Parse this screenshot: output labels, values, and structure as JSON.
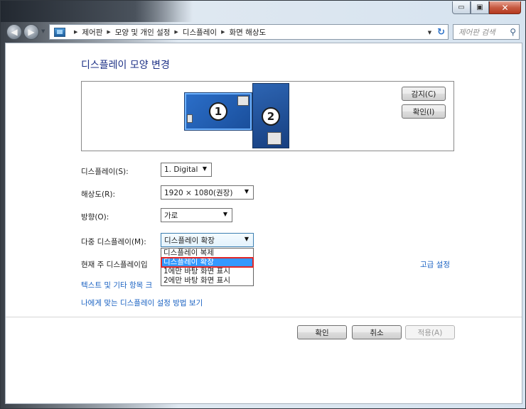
{
  "window": {
    "minimize_glyph": "▭",
    "maximize_glyph": "▣",
    "close_glyph": "✕"
  },
  "nav": {
    "back_glyph": "◀",
    "forward_glyph": "▶",
    "breadcrumbs": [
      "제어판",
      "모양 및 개인 설정",
      "디스플레이",
      "화면 해상도"
    ],
    "search_placeholder": "제어판 검색",
    "search_icon": "search-icon",
    "refresh_icon": "refresh-icon"
  },
  "page": {
    "title": "디스플레이 모양 변경"
  },
  "preview": {
    "monitor1_number": "1",
    "monitor2_number": "2",
    "detect_label": "감지(C)",
    "identify_label": "확인(I)"
  },
  "settings": {
    "display_label": "디스플레이(S):",
    "display_value": "1. Digital",
    "resolution_label": "해상도(R):",
    "resolution_value": "1920 × 1080(권장)",
    "orientation_label": "방향(O):",
    "orientation_value": "가로",
    "multi_display_label": "다중 디스플레이(M):",
    "multi_display_value": "디스플레이 확장",
    "multi_display_options": [
      "디스플레이 복제",
      "디스플레이 확장",
      "1에만 바탕 화면 표시",
      "2에만 바탕 화면 표시"
    ],
    "current_main_text": "현재 주 디스플레이입",
    "advanced_link": "고급 설정"
  },
  "links": {
    "text_size_link": "텍스트 및 기타 항목 크",
    "which_settings_link": "나에게 맞는 디스플레이 설정 방법 보기"
  },
  "footer": {
    "ok_label": "확인",
    "cancel_label": "취소",
    "apply_label": "적용(A)"
  }
}
